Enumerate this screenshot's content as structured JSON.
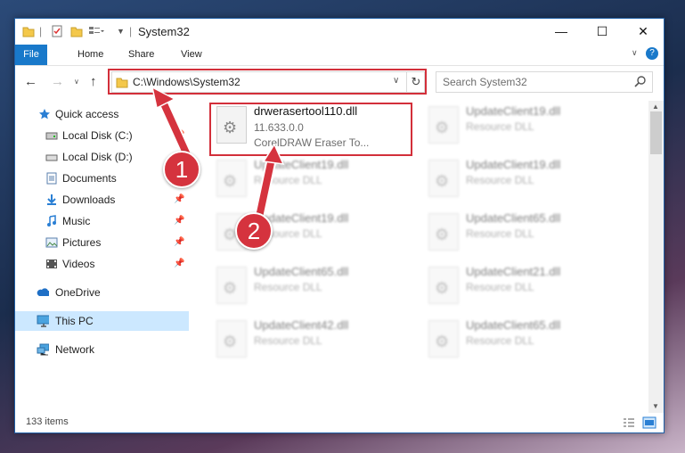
{
  "window": {
    "title": "System32",
    "controls": {
      "minimize": "—",
      "maximize": "☐",
      "close": "✕"
    }
  },
  "ribbon": {
    "tabs": [
      "File",
      "Home",
      "Share",
      "View"
    ]
  },
  "address_bar": {
    "path": "C:\\Windows\\System32",
    "search_placeholder": "Search System32"
  },
  "nav_pane": {
    "items": [
      {
        "label": "Quick access",
        "icon": "star-icon"
      },
      {
        "label": "Local Disk (C:)",
        "icon": "drive-icon",
        "pinned": true
      },
      {
        "label": "Local Disk (D:)",
        "icon": "drive-icon",
        "pinned": false
      },
      {
        "label": "Documents",
        "icon": "documents-icon",
        "pinned": true
      },
      {
        "label": "Downloads",
        "icon": "downloads-icon",
        "pinned": true
      },
      {
        "label": "Music",
        "icon": "music-icon",
        "pinned": true
      },
      {
        "label": "Pictures",
        "icon": "pictures-icon",
        "pinned": true
      },
      {
        "label": "Videos",
        "icon": "videos-icon",
        "pinned": true
      },
      {
        "label": "OneDrive",
        "icon": "cloud-icon"
      },
      {
        "label": "This PC",
        "icon": "computer-icon",
        "selected": true
      },
      {
        "label": "Network",
        "icon": "network-icon"
      }
    ]
  },
  "content": {
    "highlighted_file": {
      "name": "drwerasertool110.dll",
      "version": "11.633.0.0",
      "description": "CorelDRAW Eraser To..."
    },
    "files": [
      {
        "name": "UpdateClient19.dll",
        "type": "Resource DLL"
      },
      {
        "name": "UpdateClient19.dll",
        "type": "Resource DLL"
      },
      {
        "name": "UpdateClient19.dll",
        "type": "Resource DLL"
      },
      {
        "name": "UpdateClient19.dll",
        "type": "Resource DLL"
      },
      {
        "name": "UpdateClient65.dll",
        "type": "Resource DLL"
      },
      {
        "name": "UpdateClient65.dll",
        "type": "Resource DLL"
      },
      {
        "name": "UpdateClient21.dll",
        "type": "Resource DLL"
      },
      {
        "name": "UpdateClient42.dll",
        "type": "Resource DLL"
      },
      {
        "name": "UpdateClient65.dll",
        "type": "Resource DLL"
      }
    ]
  },
  "status": {
    "item_count": "133 items"
  },
  "callouts": [
    "1",
    "2"
  ],
  "colors": {
    "accent": "#1979ca",
    "highlight": "#d32f3a",
    "selection": "#cce8ff"
  }
}
